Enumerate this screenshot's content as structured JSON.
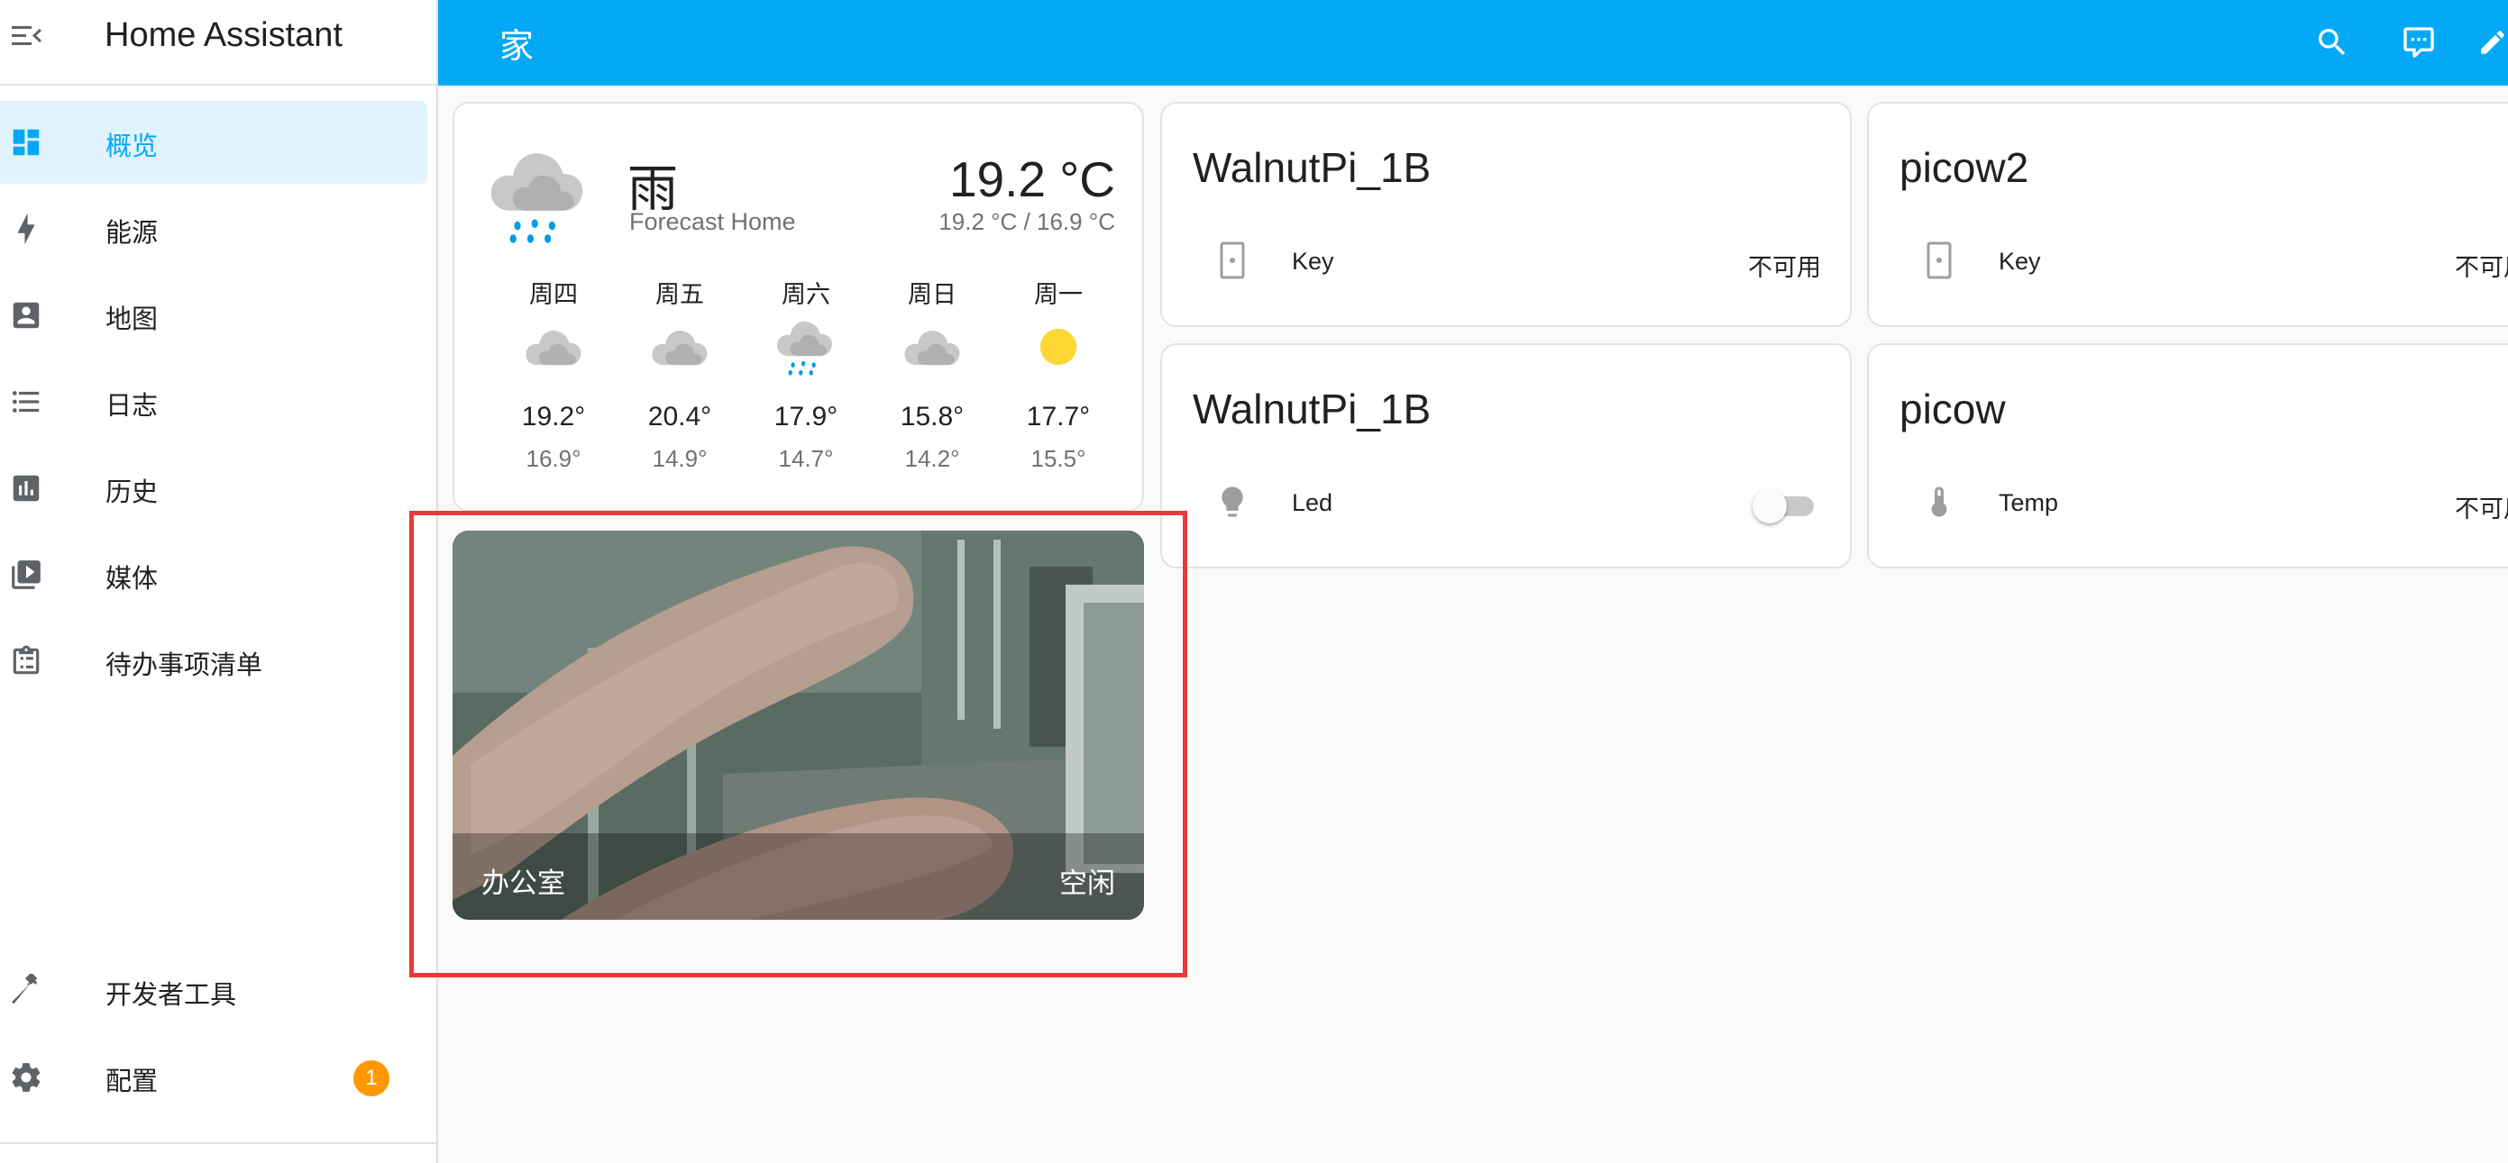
{
  "app": {
    "title": "Home Assistant"
  },
  "sidebar": {
    "items": [
      {
        "label": "概览",
        "icon": "view-dashboard-icon",
        "active": true
      },
      {
        "label": "能源",
        "icon": "lightning-bolt-icon"
      },
      {
        "label": "地图",
        "icon": "account-box-icon"
      },
      {
        "label": "日志",
        "icon": "format-list-bulleted-icon"
      },
      {
        "label": "历史",
        "icon": "chart-box-icon"
      },
      {
        "label": "媒体",
        "icon": "play-box-multiple-icon"
      },
      {
        "label": "待办事项清单",
        "icon": "clipboard-list-icon"
      }
    ],
    "bottom": [
      {
        "label": "开发者工具",
        "icon": "hammer-icon"
      },
      {
        "label": "配置",
        "icon": "cog-icon",
        "badge": "1"
      }
    ]
  },
  "topbar": {
    "title": "家",
    "icons": [
      "search-icon",
      "assist-chat-icon",
      "edit-pencil-icon"
    ]
  },
  "weather": {
    "state": "雨",
    "name": "Forecast Home",
    "temperature": "19.2 °C",
    "hilo": "19.2 °C / 16.9 °C",
    "forecast": [
      {
        "day": "周四",
        "icon": "cloudy-icon",
        "high": "19.2°",
        "low": "16.9°"
      },
      {
        "day": "周五",
        "icon": "cloudy-icon",
        "high": "20.4°",
        "low": "14.9°"
      },
      {
        "day": "周六",
        "icon": "rainy-icon",
        "high": "17.9°",
        "low": "14.7°"
      },
      {
        "day": "周日",
        "icon": "cloudy-icon",
        "high": "15.8°",
        "low": "14.2°"
      },
      {
        "day": "周一",
        "icon": "sunny-icon",
        "high": "17.7°",
        "low": "15.5°"
      }
    ]
  },
  "entity_cards": [
    {
      "title": "WalnutPi_1B",
      "entity": "Key",
      "state": "不可用",
      "icon": "door-sensor-icon"
    },
    {
      "title": "picow2",
      "entity": "Key",
      "state": "不可用",
      "icon": "door-sensor-icon"
    },
    {
      "title": "WalnutPi_1B",
      "entity": "Led",
      "state": "off",
      "icon": "lightbulb-icon"
    },
    {
      "title": "picow",
      "entity": "Temp",
      "state": "不可用",
      "icon": "thermometer-icon"
    }
  ],
  "camera": {
    "name": "办公室",
    "state": "空闲"
  },
  "colors": {
    "primary": "#03a9f4",
    "sidebar_active_bg": "#e1f3fc",
    "badge": "#ff9800",
    "highlight": "#e83a3a",
    "sun": "#fdd835",
    "rain": "#039be5"
  }
}
